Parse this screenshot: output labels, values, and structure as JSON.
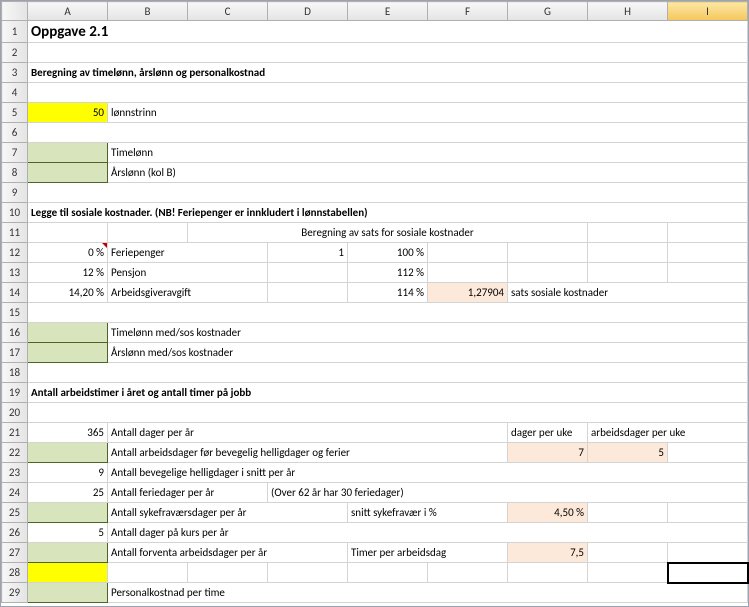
{
  "headers": {
    "cols": [
      "A",
      "B",
      "C",
      "D",
      "E",
      "F",
      "G",
      "H",
      "I"
    ]
  },
  "r1": {
    "A": "Oppgave 2.1"
  },
  "r3": {
    "A": "Beregning av timelønn, årslønn og personalkostnad"
  },
  "r5": {
    "A": "50",
    "B": "lønnstrinn"
  },
  "r7": {
    "B": "Timelønn"
  },
  "r8": {
    "B": "Årslønn (kol B)"
  },
  "r10": {
    "A": "Legge til sosiale kostnader. (NB! Feriepenger er innkludert i lønnstabellen)"
  },
  "r11": {
    "C": "Beregning av sats for sosiale kostnader"
  },
  "r12": {
    "A": "0 %",
    "B": "Feriepenger",
    "D": "1",
    "E": "100 %"
  },
  "r13": {
    "A": "12 %",
    "B": "Pensjon",
    "E": "112 %"
  },
  "r14": {
    "A": "14,20 %",
    "B": "Arbeidsgiveravgift",
    "E": "114 %",
    "F": "1,27904",
    "G": "sats sosiale kostnader"
  },
  "r16": {
    "B": "Timelønn med/sos kostnader"
  },
  "r17": {
    "B": "Årslønn med/sos kostnader"
  },
  "r19": {
    "A": "Antall arbeidstimer i året og antall timer på jobb"
  },
  "r21": {
    "A": "365",
    "B": "Antall dager per år",
    "G": "dager per uke",
    "H": "arbeidsdager per uke"
  },
  "r22": {
    "B": "Antall arbeidsdager før bevegelig helligdager og ferier",
    "G": "7",
    "H": "5"
  },
  "r23": {
    "A": "9",
    "B": "Antall bevegelige helligdager i snitt per år"
  },
  "r24": {
    "A": "25",
    "B": "Antall feriedager per år",
    "D": "(Over 62 år har 30 feriedager)"
  },
  "r25": {
    "B": "Antall sykefraværsdager per år",
    "E": "snitt sykefravær i %",
    "G": "4,50 %"
  },
  "r26": {
    "A": "5",
    "B": "Antall dager på kurs per år"
  },
  "r27": {
    "B": "Antall forventa arbeidsdager per år",
    "E": "Timer per arbeidsdag",
    "G": "7,5"
  },
  "r29": {
    "B": "Personalkostnad per time"
  },
  "chart_data": {
    "type": "table",
    "title": "Oppgave 2.1 — Beregning av timelønn, årslønn og personalkostnad",
    "sections": [
      {
        "label": "lønnstrinn",
        "value": 50
      },
      {
        "label": "Feriepenger",
        "pct": 0,
        "base": 1,
        "cum_pct": 100
      },
      {
        "label": "Pensjon",
        "pct": 12,
        "cum_pct": 112
      },
      {
        "label": "Arbeidsgiveravgift",
        "pct": 14.2,
        "cum_pct": 114,
        "sats_sosiale_kostnader": 1.27904
      },
      {
        "label": "Antall dager per år",
        "value": 365
      },
      {
        "label": "dager per uke",
        "value": 7
      },
      {
        "label": "arbeidsdager per uke",
        "value": 5
      },
      {
        "label": "Antall bevegelige helligdager i snitt per år",
        "value": 9
      },
      {
        "label": "Antall feriedager per år",
        "value": 25,
        "note": "(Over 62 år har 30 feriedager)"
      },
      {
        "label": "snitt sykefravær i %",
        "value": 4.5
      },
      {
        "label": "Antall dager på kurs per år",
        "value": 5
      },
      {
        "label": "Timer per arbeidsdag",
        "value": 7.5
      }
    ]
  }
}
